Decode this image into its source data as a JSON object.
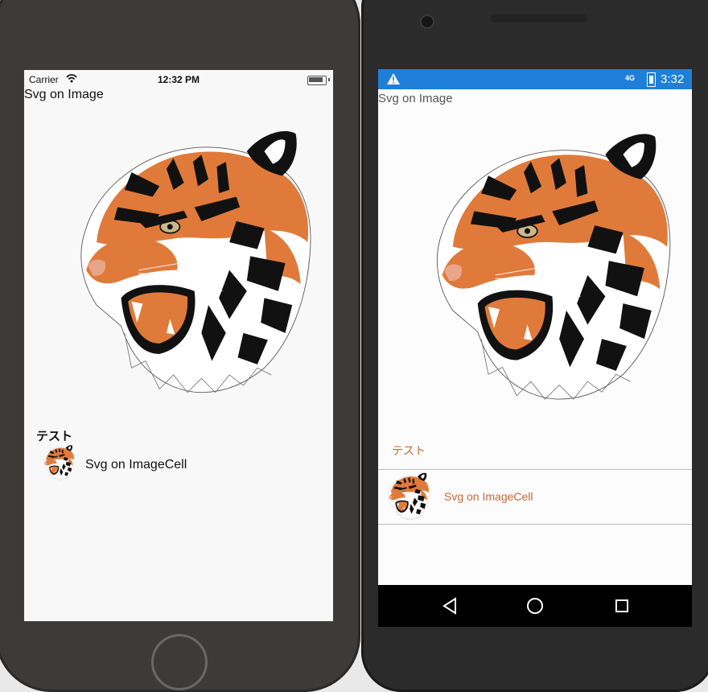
{
  "ios": {
    "carrier": "Carrier",
    "time": "12:32 PM",
    "page_title": "Svg on Image",
    "section_header": "テスト",
    "cell_label": "Svg on ImageCell"
  },
  "android": {
    "network": "4G",
    "time": "3:32",
    "page_title": "Svg on Image",
    "section_header": "テスト",
    "cell_label": "Svg on ImageCell"
  },
  "colors": {
    "android_status_bar": "#1e7fd8",
    "android_accent": "#c8673a",
    "tiger_orange": "#e07a3a"
  },
  "icons": [
    "tiger-image",
    "wifi-icon",
    "battery-icon",
    "warning-icon",
    "back-icon",
    "home-icon",
    "recents-icon"
  ]
}
